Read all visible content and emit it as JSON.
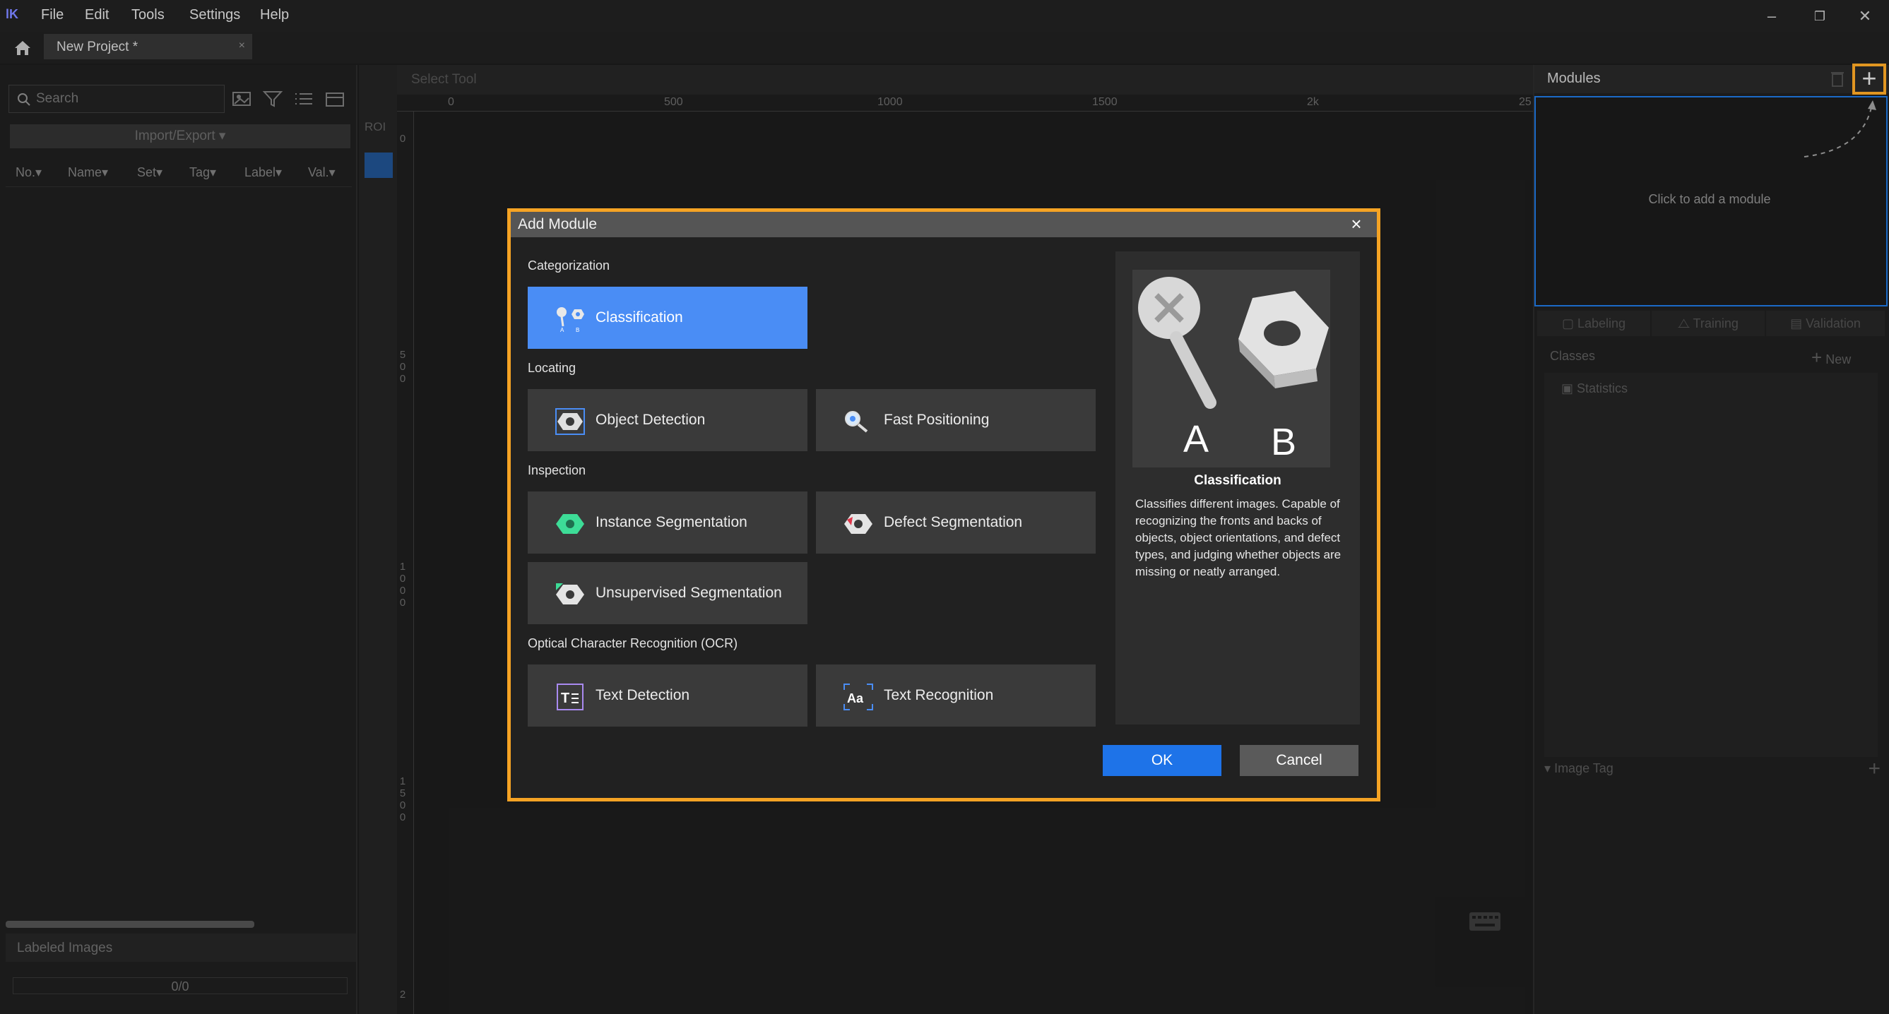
{
  "menubar": {
    "items": [
      "File",
      "Edit",
      "Tools",
      "Settings",
      "Help"
    ]
  },
  "tabs": [
    {
      "label": "New Project *",
      "close": "×"
    }
  ],
  "left_panel": {
    "search_placeholder": "Search",
    "import_export": "Import/Export ▾",
    "columns": [
      "No.▾",
      "Name▾",
      "Set▾",
      "Tag▾",
      "Label▾",
      "Val.▾"
    ],
    "labeled_images": "Labeled Images",
    "progress": "0/0"
  },
  "canvas": {
    "roi_label": "ROI",
    "tool_hint": "Select Tool",
    "ruler_h": [
      "0",
      "500",
      "1000",
      "1500",
      "2k",
      "25"
    ],
    "ruler_v": [
      [
        "0"
      ],
      [
        "5",
        "0",
        "0"
      ],
      [
        "1",
        "0",
        "0",
        "0"
      ],
      [
        "1",
        "5",
        "0",
        "0"
      ],
      [
        "2"
      ]
    ]
  },
  "right_panel": {
    "title": "Modules",
    "add_symbol": "+",
    "hint": "Click to add a module",
    "tabs": [
      "Labeling",
      "Training",
      "Validation"
    ],
    "classes_label": "Classes",
    "new_label": "New",
    "statistics_label": "Statistics",
    "image_tag_label": "Image Tag"
  },
  "dialog": {
    "title": "Add Module",
    "close": "×",
    "sections": [
      {
        "title": "Categorization",
        "modules": [
          {
            "label": "Classification",
            "icon": "classification-icon",
            "selected": true
          }
        ]
      },
      {
        "title": "Locating",
        "modules": [
          {
            "label": "Object Detection",
            "icon": "object-detection-icon"
          },
          {
            "label": "Fast Positioning",
            "icon": "fast-positioning-icon"
          }
        ]
      },
      {
        "title": "Inspection",
        "modules": [
          {
            "label": "Instance Segmentation",
            "icon": "instance-segmentation-icon"
          },
          {
            "label": "Defect Segmentation",
            "icon": "defect-segmentation-icon"
          },
          {
            "label": "Unsupervised Segmentation",
            "icon": "unsupervised-segmentation-icon"
          }
        ]
      },
      {
        "title": "Optical Character Recognition (OCR)",
        "modules": [
          {
            "label": "Text Detection",
            "icon": "text-detection-icon"
          },
          {
            "label": "Text Recognition",
            "icon": "text-recognition-icon"
          }
        ]
      }
    ],
    "preview": {
      "title": "Classification",
      "image_letters": [
        "A",
        "B"
      ],
      "description": "Classifies different images. Capable of recognizing the fronts and backs of objects, object orientations, and defect types, and judging whether objects are missing or neatly arranged."
    },
    "ok_label": "OK",
    "cancel_label": "Cancel"
  },
  "colors": {
    "accent_orange": "#f5a324",
    "selected_blue": "#4a8df5",
    "ok_blue": "#1e73e8",
    "panel_border_blue": "#1e73d8"
  }
}
